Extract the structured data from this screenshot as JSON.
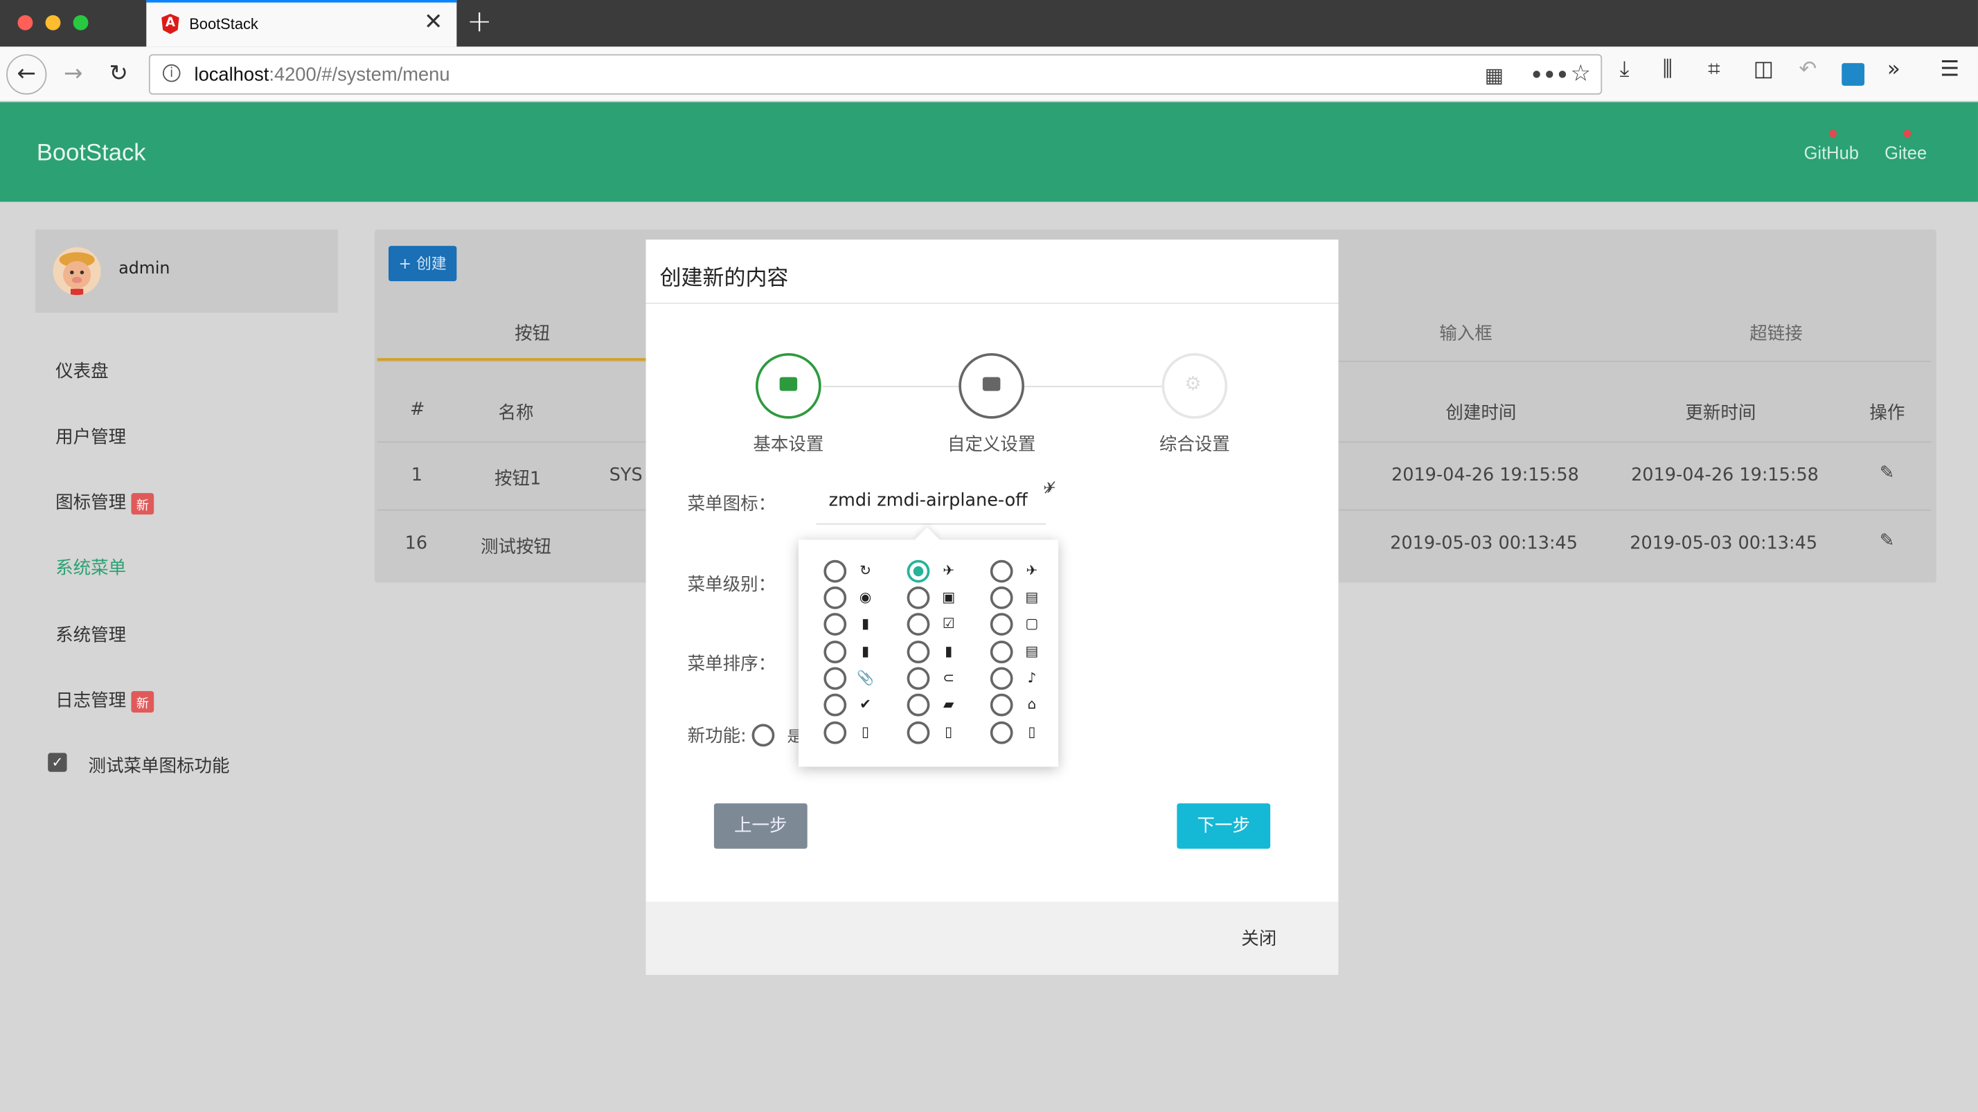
{
  "browser": {
    "tab_title": "BootStack",
    "url_host": "localhost",
    "url_rest": ":4200/#/system/menu"
  },
  "app": {
    "brand": "BootStack",
    "header_links": [
      "GitHub",
      "Gitee"
    ]
  },
  "sidebar": {
    "username": "admin",
    "items": [
      {
        "label": "仪表盘"
      },
      {
        "label": "用户管理"
      },
      {
        "label": "图标管理",
        "badge": "新"
      },
      {
        "label": "系统菜单"
      },
      {
        "label": "系统管理"
      },
      {
        "label": "日志管理",
        "badge": "新"
      },
      {
        "label": "测试菜单图标功能"
      }
    ]
  },
  "main": {
    "create_label": "+ 创建",
    "tabs": [
      "按钮",
      "输入框",
      "超链接"
    ],
    "columns": [
      "#",
      "名称",
      "创建时间",
      "更新时间",
      "操作"
    ],
    "rows": [
      {
        "id": "1",
        "name": "按钮1",
        "code": "SYS",
        "created": "2019-04-26 19:15:58",
        "updated": "2019-04-26 19:15:58"
      },
      {
        "id": "16",
        "name": "测试按钮",
        "created": "2019-05-03 00:13:45",
        "updated": "2019-05-03 00:13:45"
      }
    ]
  },
  "modal": {
    "title": "创建新的内容",
    "steps": [
      "基本设置",
      "自定义设置",
      "综合设置"
    ],
    "labels": {
      "icon": "菜单图标：",
      "level": "菜单级别：",
      "sort": "菜单排序：",
      "feature": "新功能:"
    },
    "feature_partial": "是",
    "icon_value": "zmdi zmdi-airplane-off",
    "prev_label": "上一步",
    "next_label": "下一步",
    "close_label": "关闭"
  },
  "colors": {
    "header_green": "#2ba174",
    "step_active": "#2e9a3e",
    "radio_selected": "#26b39a",
    "next_button": "#15b8d5",
    "badge_red": "#e05a5a"
  }
}
